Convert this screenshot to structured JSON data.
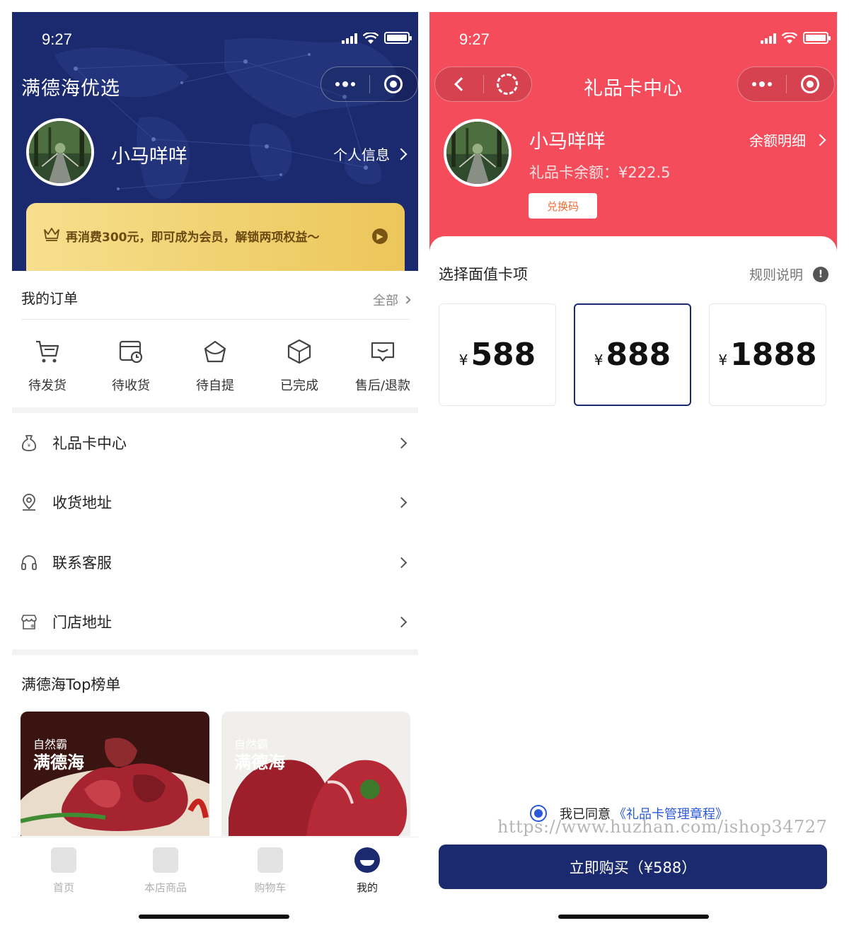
{
  "colors": {
    "brand_navy": "#1b2a6e",
    "gift_red": "#f44c5b",
    "gold": "#ecc659",
    "link_blue": "#2b59d9"
  },
  "left": {
    "status": {
      "time": "9:27",
      "battery_level": 1.0
    },
    "app_title": "满德海优选",
    "user": {
      "name": "小马咩咩",
      "personal_info": "个人信息"
    },
    "member_banner": "再消费300元，即可成为会员，解锁两项权益～",
    "orders": {
      "title": "我的订单",
      "all": "全部",
      "items": [
        {
          "label": "待发货",
          "icon": "cart-icon"
        },
        {
          "label": "待收货",
          "icon": "delivery-icon"
        },
        {
          "label": "待自提",
          "icon": "pickup-bag-icon"
        },
        {
          "label": "已完成",
          "icon": "box-icon"
        },
        {
          "label": "售后/退款",
          "icon": "refund-icon"
        }
      ]
    },
    "menu": [
      {
        "label": "礼品卡中心",
        "icon": "gift-bag-icon"
      },
      {
        "label": "收货地址",
        "icon": "location-icon"
      },
      {
        "label": "联系客服",
        "icon": "headset-icon"
      },
      {
        "label": "门店地址",
        "icon": "store-icon"
      }
    ],
    "top_title": "满德海Top榜单",
    "products": [
      {
        "caption_line1": "自然霸",
        "caption_line2": "满德海"
      },
      {
        "caption_line1": "自然霸",
        "caption_line2": "满德海"
      }
    ],
    "tabbar": [
      {
        "label": "首页",
        "icon": "home-icon"
      },
      {
        "label": "本店商品",
        "icon": "shop-icon"
      },
      {
        "label": "购物车",
        "icon": "cart-icon"
      },
      {
        "label": "我的",
        "icon": "profile-icon"
      }
    ]
  },
  "right": {
    "status": {
      "time": "9:27",
      "battery_level": 1.0
    },
    "nav_title": "礼品卡中心",
    "user": {
      "name": "小马咩咩",
      "balance_detail": "余额明细",
      "gift_balance": "礼品卡余额：¥222.5",
      "redeem": "兑换码"
    },
    "select_title": "选择面值卡项",
    "rules": "规则说明",
    "rules_icon": "!",
    "currency": "¥",
    "cards": [
      {
        "amount": "588",
        "selected": false
      },
      {
        "amount": "888",
        "selected": true
      },
      {
        "amount": "1888",
        "selected": false
      }
    ],
    "agree_text": "我已同意",
    "agree_link": "《礼品卡管理章程》",
    "watermark": "https://www.huzhan.com/ishop34727",
    "buy_button": "立即购买（¥588）"
  }
}
